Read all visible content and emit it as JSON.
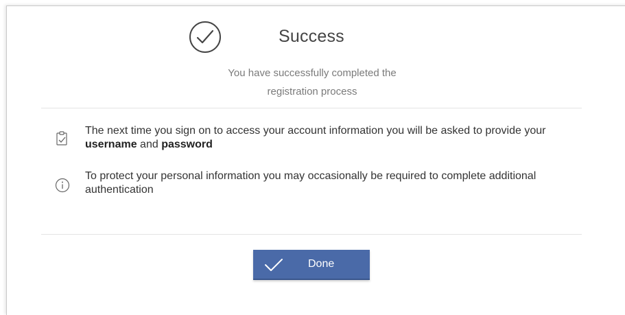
{
  "dialog": {
    "status_icon": "checkmark-circle-icon",
    "title": "Success",
    "subtitle_line1": "You have successfully completed the",
    "subtitle_line2": "registration process"
  },
  "info_items": [
    {
      "icon": "clipboard-check-icon",
      "text_before": "The next time you sign on to access your account information you will be asked to provide your ",
      "bold1": "username",
      "text_mid": " and ",
      "bold2": "password"
    },
    {
      "icon": "info-circle-icon",
      "text": "To protect your personal information you may occasionally be required to complete additional authentication"
    }
  ],
  "actions": {
    "done_label": "Done",
    "done_icon": "checkmark-icon"
  },
  "colors": {
    "button_bg": "#4a6aa8",
    "title_text": "#444444",
    "subtitle_text": "#7a7a7a",
    "body_text": "#333333"
  }
}
